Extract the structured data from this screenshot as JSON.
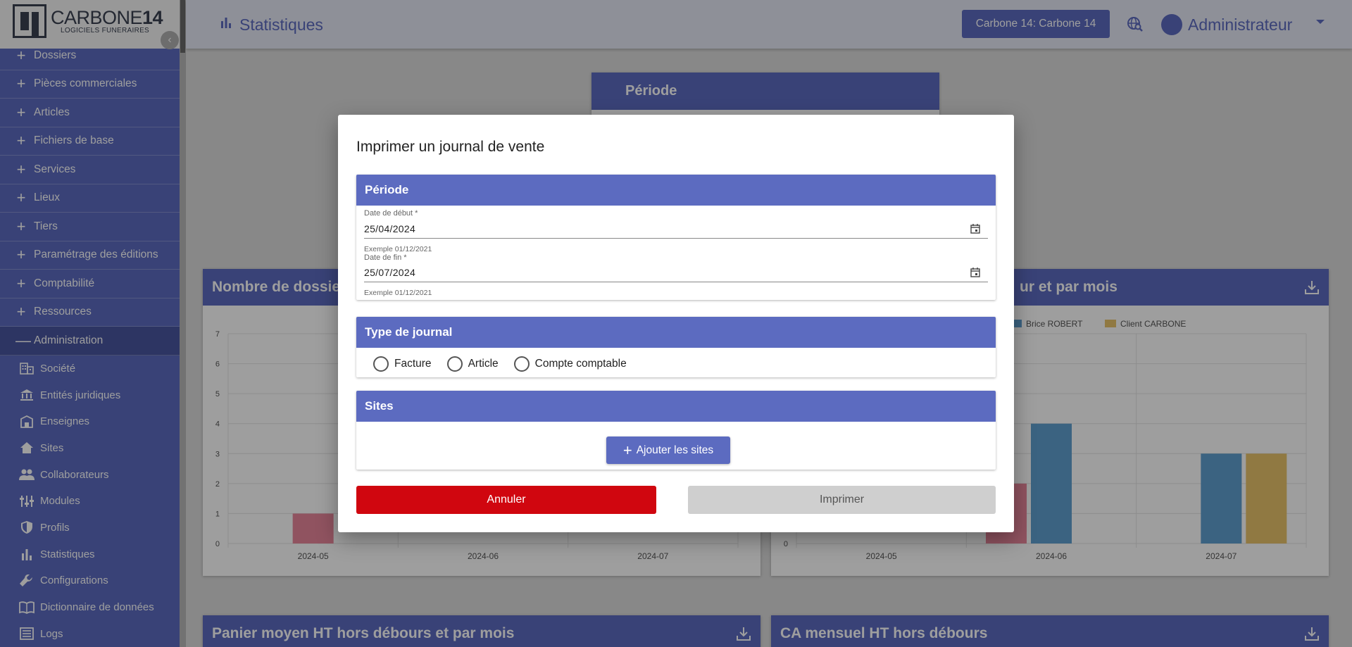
{
  "brand": {
    "name_main": "CARBONE",
    "name_num": "14",
    "tagline": "LOGICIELS FUNERAIRES"
  },
  "sidebar": {
    "items": [
      {
        "label": "Dossiers"
      },
      {
        "label": "Pièces commerciales"
      },
      {
        "label": "Articles"
      },
      {
        "label": "Fichiers de base"
      },
      {
        "label": "Services"
      },
      {
        "label": "Lieux"
      },
      {
        "label": "Tiers"
      },
      {
        "label": "Paramétrage des éditions"
      },
      {
        "label": "Comptabilité"
      },
      {
        "label": "Ressources"
      },
      {
        "label": "Administration"
      }
    ],
    "admin_items": [
      {
        "label": "Société",
        "icon": "building-icon"
      },
      {
        "label": "Entités juridiques",
        "icon": "bank-icon"
      },
      {
        "label": "Enseignes",
        "icon": "store-icon"
      },
      {
        "label": "Sites",
        "icon": "home-icon"
      },
      {
        "label": "Collaborateurs",
        "icon": "people-icon"
      },
      {
        "label": "Modules",
        "icon": "modules-icon"
      },
      {
        "label": "Profils",
        "icon": "shield-icon"
      },
      {
        "label": "Statistiques",
        "icon": "bar-chart-icon"
      },
      {
        "label": "Configurations",
        "icon": "wrench-icon"
      },
      {
        "label": "Dictionnaire de données",
        "icon": "book-icon"
      },
      {
        "label": "Logs",
        "icon": "list-icon"
      }
    ]
  },
  "header": {
    "title": "Statistiques",
    "company_button": "Carbone 14: Carbone 14",
    "user_name": "Administrateur"
  },
  "background": {
    "periode_title": "Période",
    "card1_title": "Nombre de dossiers",
    "card2_title": "ur et par mois",
    "card3_title": "Panier moyen HT hors débours et par mois",
    "card4_title": "CA mensuel HT hors débours"
  },
  "chart_data": [
    {
      "type": "bar",
      "title": "Nombre de dossiers",
      "categories": [
        "2024-05",
        "2024-06",
        "2024-07"
      ],
      "y_ticks": [
        "0",
        "1",
        "2",
        "3",
        "4",
        "5",
        "6",
        "7"
      ],
      "ylim": [
        0,
        7
      ],
      "series": [
        {
          "values": [
            1,
            null,
            null
          ],
          "color": "#e8879c"
        }
      ]
    },
    {
      "type": "bar",
      "title": "ur et par mois",
      "categories": [
        "2024-05",
        "2024-06",
        "2024-07"
      ],
      "y_ticks": [
        "0"
      ],
      "ylim": [
        0,
        7
      ],
      "legend": [
        "Brice ROBERT",
        "Client CARBONE"
      ],
      "series": [
        {
          "values": [
            null,
            2,
            null
          ],
          "color": "#e8879c"
        },
        {
          "name": "Brice ROBERT",
          "values": [
            null,
            4,
            3
          ],
          "color": "#5fa0d0"
        },
        {
          "name": "Client CARBONE",
          "values": [
            null,
            null,
            3
          ],
          "color": "#e8c36b"
        }
      ]
    }
  ],
  "modal": {
    "title": "Imprimer un journal de vente",
    "periode": {
      "header": "Période",
      "start_label": "Date de début *",
      "start_value": "25/04/2024",
      "start_hint": "Exemple 01/12/2021",
      "end_label": "Date de fin *",
      "end_value": "25/07/2024",
      "end_hint": "Exemple 01/12/2021"
    },
    "type": {
      "header": "Type de journal",
      "options": [
        "Facture",
        "Article",
        "Compte comptable"
      ]
    },
    "sites": {
      "header": "Sites",
      "add_button": "Ajouter les sites"
    },
    "cancel_button": "Annuler",
    "print_button": "Imprimer"
  }
}
